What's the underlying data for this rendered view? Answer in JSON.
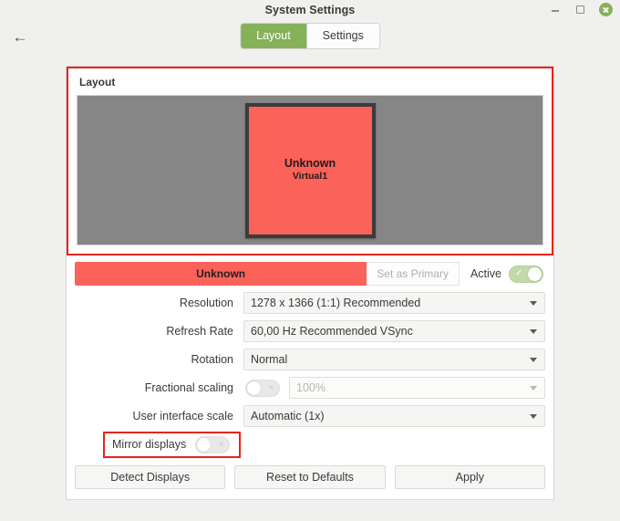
{
  "window": {
    "title": "System Settings",
    "controls": {
      "minimize": "minimize-icon",
      "maximize": "maximize-icon",
      "close": "close-icon"
    }
  },
  "header": {
    "back_icon": "←",
    "tabs": [
      {
        "label": "Layout",
        "active": true
      },
      {
        "label": "Settings",
        "active": false
      }
    ]
  },
  "layout_group": {
    "title": "Layout",
    "monitor": {
      "name": "Unknown",
      "id": "Virtual1",
      "color": "#fb6259",
      "border_color": "#3c3c3c"
    },
    "canvas_color": "#868686",
    "annotation_color": "#e8231b"
  },
  "display_row": {
    "chip_label": "Unknown",
    "set_primary_label": "Set as Primary",
    "active_label": "Active",
    "active_toggle_on": true,
    "toggle_on_mark": "✓"
  },
  "form": {
    "rows": [
      {
        "label": "Resolution",
        "value": "1278 x 1366 (1:1)     Recommended"
      },
      {
        "label": "Refresh Rate",
        "value": "60,00 Hz  Recommended  VSync"
      },
      {
        "label": "Rotation",
        "value": "Normal"
      },
      {
        "label": "Fractional scaling",
        "value": "100%"
      },
      {
        "label": "User interface scale",
        "value": "Automatic (1x)"
      }
    ],
    "fractional_toggle_on": false,
    "toggle_off_mark": "×"
  },
  "mirror": {
    "label": "Mirror displays",
    "toggle_on": false,
    "toggle_off_mark": "×"
  },
  "buttons": {
    "detect": "Detect Displays",
    "reset": "Reset to Defaults",
    "apply": "Apply"
  }
}
